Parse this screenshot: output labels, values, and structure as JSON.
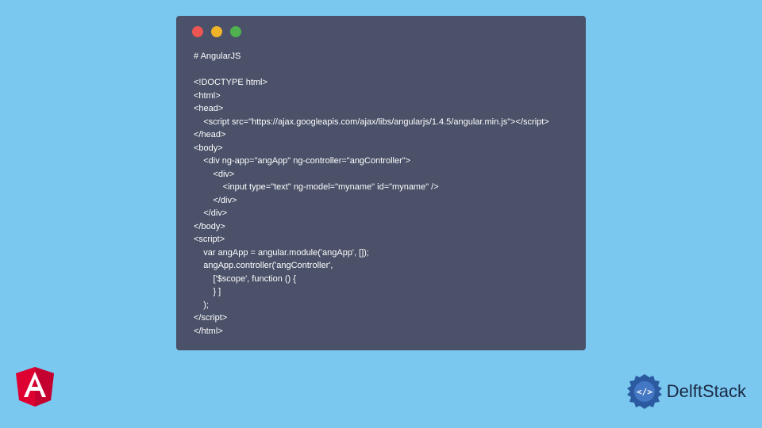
{
  "code": {
    "title": "# AngularJS",
    "lines": [
      "<!DOCTYPE html>",
      "<html>",
      "<head>",
      "    <script src=\"https://ajax.googleapis.com/ajax/libs/angularjs/1.4.5/angular.min.js\"></script>",
      "</head>",
      "<body>",
      "    <div ng-app=\"angApp\" ng-controller=\"angController\">",
      "        <div>",
      "            <input type=\"text\" ng-model=\"myname\" id=\"myname\" />",
      "        </div>",
      "    </div>",
      "</body>",
      "<script>",
      "    var angApp = angular.module('angApp', []);",
      "    angApp.controller('angController',",
      "        ['$scope', function () {",
      "        } ]",
      "    );",
      "</script>",
      "</html>"
    ]
  },
  "brand": {
    "name": "DelftStack"
  }
}
